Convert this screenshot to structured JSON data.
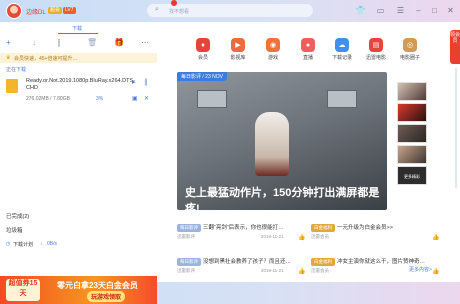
{
  "titlebar": {
    "username": "边缘DL",
    "vip_badge": "超会",
    "level_badge": "LV7",
    "search_placeholder": "找不想看",
    "window_icons": [
      "skin-icon",
      "message-icon",
      "menu-icon",
      "minimize-icon",
      "maximize-icon",
      "close-icon"
    ]
  },
  "left": {
    "tab": "下载",
    "notice": "会员快速，45+倍速可提升…",
    "section_downloading": "正在下载",
    "download": {
      "name": "Ready.or.Not.2019.1080p.BluRay.x264.DTS-CHD",
      "size": "276.02MB / 7.80GB",
      "percent": "3%"
    },
    "completed": "已完成(2)",
    "trash": "垃圾箱",
    "speed_label": "下载计划",
    "speed_value": "0B/s",
    "banner": {
      "coupon": "超值券15天",
      "title": "零元白拿23天白金会员",
      "cta": "玩游戏领取"
    }
  },
  "right": {
    "nav": [
      {
        "label": "会员",
        "color": "#e8433a"
      },
      {
        "label": "影视库",
        "color": "#ef6b3f"
      },
      {
        "label": "游戏",
        "color": "#f0723a"
      },
      {
        "label": "直播",
        "color": "#f05d5d"
      },
      {
        "label": "下载记录",
        "color": "#3f8ff0"
      },
      {
        "label": "迅雷电影",
        "color": "#e6453d"
      },
      {
        "label": "电影圈子",
        "color": "#d29a52"
      }
    ],
    "hero": {
      "tag": "每日影评 / 23 NOV",
      "caption": "史上最猛动作片，150分钟打出满屏都是疼!"
    },
    "thumb_more": "更多精彩",
    "side_btn": "领会员",
    "articles": [
      {
        "label": "每日影评",
        "title": "三翻“亮剑”后表示，你也很能打…",
        "author": "迅雷影评",
        "date": "2019-11-21"
      },
      {
        "label": "白金福利",
        "title": "一元升级为白金会员>>",
        "author": "迅雷会员",
        "date": ""
      },
      {
        "label": "每日影评",
        "title": "没想到黑社会教养了孩子？而且还…",
        "author": "迅雷影评",
        "date": "2019-11-21"
      },
      {
        "label": "白金福利",
        "title": "冲女主演你就这么干，图片赞神奇…",
        "author": "迅雷会员",
        "date": ""
      }
    ],
    "more": "更多内容>"
  }
}
